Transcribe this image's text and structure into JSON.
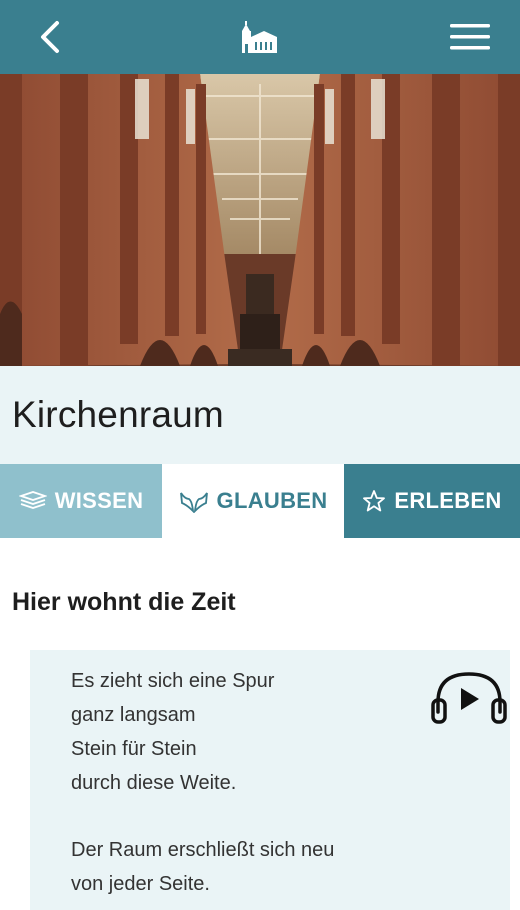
{
  "app": {
    "back_icon": "chevron-left-icon",
    "logo_icon": "church-icon",
    "menu_icon": "hamburger-menu-icon",
    "header_color": "#3a7f8f"
  },
  "page": {
    "title": "Kirchenraum"
  },
  "tabs": [
    {
      "label": "WISSEN",
      "icon": "books-icon",
      "color": "#8fc0cc"
    },
    {
      "label": "GLAUBEN",
      "icon": "praying-hands-icon",
      "color": "#ffffff"
    },
    {
      "label": "ERLEBEN",
      "icon": "star-icon",
      "color": "#3a7f8f"
    }
  ],
  "section": {
    "heading": "Hier wohnt die Zeit"
  },
  "poem": {
    "lines": [
      "Es zieht sich eine Spur",
      "ganz langsam",
      "Stein für Stein",
      "durch diese Weite.",
      "Der Raum erschließt sich neu",
      "von jeder Seite."
    ],
    "audio_icon": "headphones-play-icon"
  }
}
